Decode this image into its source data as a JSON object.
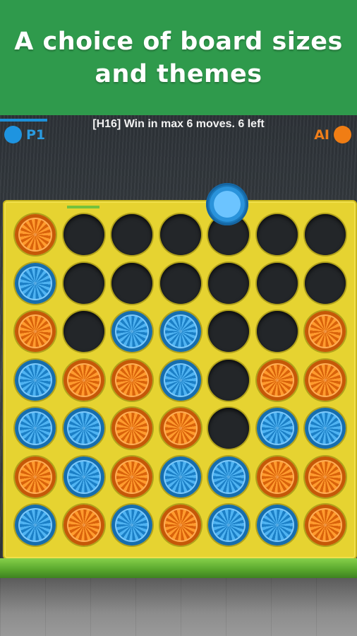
{
  "banner": {
    "line1": "A choice of board sizes",
    "line2": "and themes"
  },
  "hud": {
    "player1_label": "P1",
    "ai_label": "AI",
    "status_text": "[H16] Win in max 6 moves. 6 left"
  },
  "colors": {
    "banner_bg": "#2f9a4c",
    "board": "#e6d331",
    "player1": "#1e94e0",
    "ai": "#f07d14"
  },
  "board": {
    "columns": 7,
    "rows": 7,
    "cells": [
      [
        "orange",
        "empty",
        "empty",
        "empty",
        "empty",
        "empty",
        "empty"
      ],
      [
        "blue",
        "empty",
        "empty",
        "empty",
        "empty",
        "empty",
        "empty"
      ],
      [
        "orange",
        "empty",
        "blue",
        "blue",
        "empty",
        "empty",
        "orange"
      ],
      [
        "blue",
        "orange",
        "orange",
        "blue",
        "empty",
        "orange",
        "orange"
      ],
      [
        "blue",
        "blue",
        "orange",
        "orange",
        "empty",
        "blue",
        "blue"
      ],
      [
        "orange",
        "blue",
        "orange",
        "blue",
        "blue",
        "orange",
        "orange"
      ],
      [
        "blue",
        "orange",
        "blue",
        "orange",
        "blue",
        "blue",
        "orange"
      ]
    ],
    "selected_column": 1,
    "hover_piece": {
      "color": "blue",
      "column": 4
    }
  }
}
